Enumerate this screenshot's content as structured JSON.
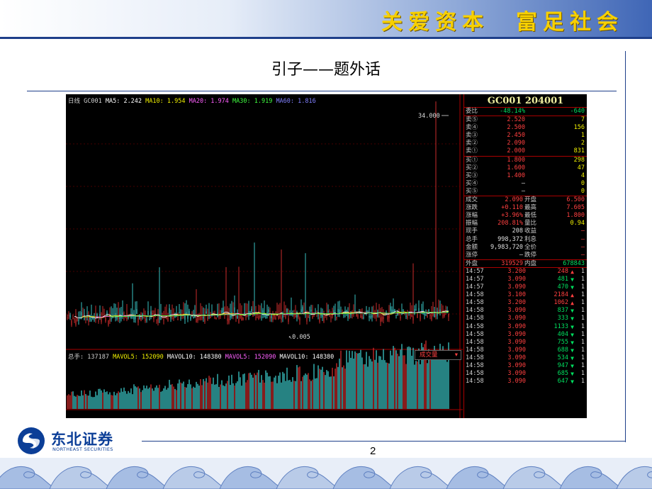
{
  "header": {
    "slogan": "关爱资本　富足社会"
  },
  "slide": {
    "title": "引子——题外话",
    "page_number": "2"
  },
  "footer": {
    "company_name": "东北证券",
    "company_en": "NORTHEAST SECURITIES"
  },
  "chart_header": {
    "period": "日线",
    "code": "GC001",
    "ma5": "MA5: 2.242",
    "ma10": "MA10: 1.954",
    "ma20": "MA20: 1.974",
    "ma30": "MA30: 1.919",
    "ma60": "MA60: 1.816"
  },
  "vol_header": {
    "total": "总手: 137187",
    "mavol5": "MAVOL5: 152090",
    "mavol10": "MAVOL10: 148380",
    "mavol5b": "MAVOL5: 152090",
    "mavol10b": "MAVOL10: 148380",
    "button": "成交量"
  },
  "annotations": {
    "peak": "34.000",
    "low": "0.005"
  },
  "quote": {
    "title": "GC001 204001",
    "weibi_label": "委比",
    "weibi": "-48.14%",
    "weicha": "-640",
    "asks": [
      {
        "label": "卖⑤",
        "price": "2.520",
        "qty": "7"
      },
      {
        "label": "卖④",
        "price": "2.500",
        "qty": "156"
      },
      {
        "label": "卖③",
        "price": "2.450",
        "qty": "1"
      },
      {
        "label": "卖②",
        "price": "2.090",
        "qty": "2"
      },
      {
        "label": "卖①",
        "price": "2.000",
        "qty": "831"
      }
    ],
    "bids": [
      {
        "label": "买①",
        "price": "1.800",
        "qty": "298"
      },
      {
        "label": "买②",
        "price": "1.600",
        "qty": "47"
      },
      {
        "label": "买③",
        "price": "1.400",
        "qty": "4"
      },
      {
        "label": "买④",
        "price": "–",
        "qty": "0"
      },
      {
        "label": "买⑤",
        "price": "–",
        "qty": "0"
      }
    ],
    "stats": [
      {
        "l1": "成交",
        "v1": "2.090",
        "l2": "开盘",
        "v2": "6.500"
      },
      {
        "l1": "涨跌",
        "v1": "+0.110",
        "l2": "最高",
        "v2": "7.605"
      },
      {
        "l1": "涨幅",
        "v1": "+3.96%",
        "l2": "最低",
        "v2": "1.800"
      },
      {
        "l1": "振幅",
        "v1": "208.81%",
        "l2": "量比",
        "v2": "0.94"
      },
      {
        "l1": "现手",
        "v1": "208",
        "l2": "收益",
        "v2": "–"
      },
      {
        "l1": "总手",
        "v1": "998,372",
        "l2": "利息",
        "v2": "–"
      },
      {
        "l1": "金额",
        "v1": "9,983,720",
        "l2": "全价",
        "v2": "–"
      },
      {
        "l1": "涨停",
        "v1": "–",
        "l2": "跌停",
        "v2": "–"
      },
      {
        "l1": "外盘",
        "v1": "319529",
        "l2": "内盘",
        "v2": "678843"
      }
    ],
    "trades": [
      {
        "time": "14:57",
        "price": "3.200",
        "vol": "248",
        "dir": "up",
        "flag": "1"
      },
      {
        "time": "14:57",
        "price": "3.090",
        "vol": "481",
        "dir": "down",
        "flag": "1"
      },
      {
        "time": "14:57",
        "price": "3.090",
        "vol": "470",
        "dir": "down",
        "flag": "1"
      },
      {
        "time": "14:58",
        "price": "3.100",
        "vol": "2184",
        "dir": "up",
        "flag": "1"
      },
      {
        "time": "14:58",
        "price": "3.200",
        "vol": "1062",
        "dir": "up",
        "flag": "1"
      },
      {
        "time": "14:58",
        "price": "3.090",
        "vol": "837",
        "dir": "down",
        "flag": "1"
      },
      {
        "time": "14:58",
        "price": "3.090",
        "vol": "333",
        "dir": "down",
        "flag": "1"
      },
      {
        "time": "14:58",
        "price": "3.090",
        "vol": "1133",
        "dir": "down",
        "flag": "1"
      },
      {
        "time": "14:58",
        "price": "3.090",
        "vol": "404",
        "dir": "down",
        "flag": "1"
      },
      {
        "time": "14:58",
        "price": "3.090",
        "vol": "755",
        "dir": "down",
        "flag": "1"
      },
      {
        "time": "14:58",
        "price": "3.090",
        "vol": "688",
        "dir": "down",
        "flag": "1"
      },
      {
        "time": "14:58",
        "price": "3.090",
        "vol": "534",
        "dir": "down",
        "flag": "1"
      },
      {
        "time": "14:58",
        "price": "3.090",
        "vol": "947",
        "dir": "down",
        "flag": "1"
      },
      {
        "time": "14:58",
        "price": "3.090",
        "vol": "685",
        "dir": "down",
        "flag": "1"
      },
      {
        "time": "14:58",
        "price": "3.090",
        "vol": "647",
        "dir": "down",
        "flag": "1"
      }
    ]
  },
  "colors": {
    "up": "#ff4040",
    "down": "#00e060",
    "candle_up": "#e03030",
    "candle_down": "#40d8d8",
    "brand": "#0b3e97",
    "slogan": "#f7d000"
  }
}
